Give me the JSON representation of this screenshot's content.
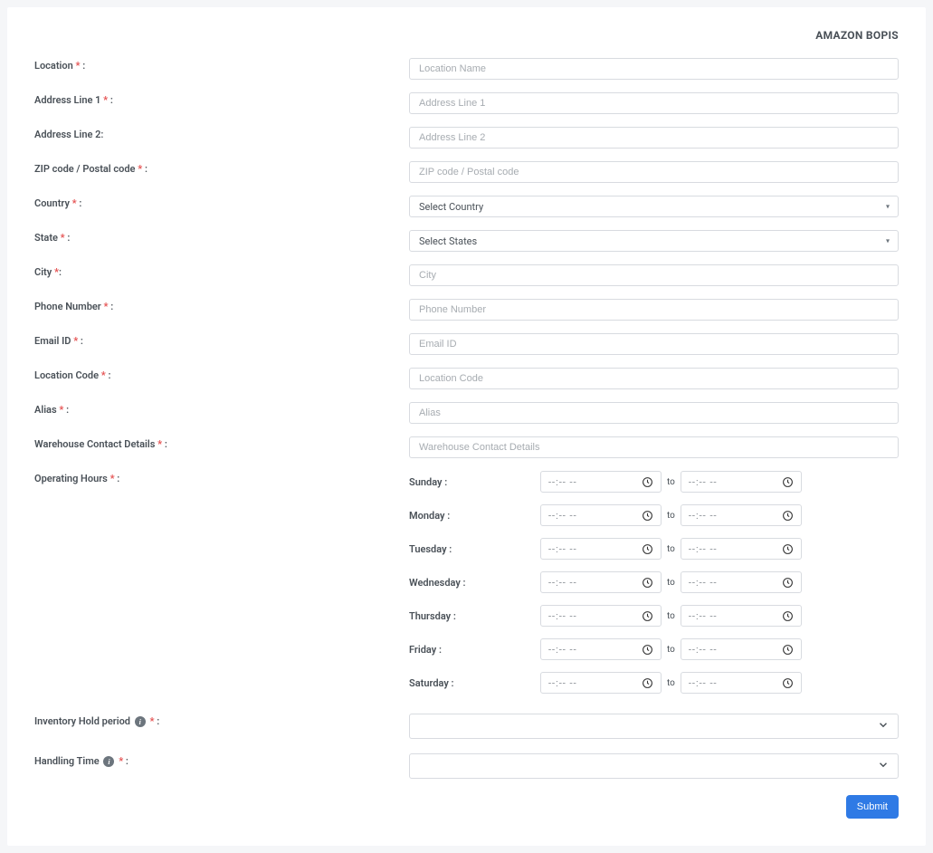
{
  "title": "AMAZON BOPIS",
  "labels": {
    "location": "Location",
    "address1": "Address Line 1",
    "address2": "Address Line 2:",
    "zip": "ZIP code / Postal code",
    "country": "Country",
    "state": "State",
    "city": "City",
    "phone": "Phone Number",
    "email": "Email ID",
    "locationCode": "Location Code",
    "alias": "Alias",
    "warehouseContact": "Warehouse Contact Details",
    "operatingHours": "Operating Hours",
    "inventoryHold": "Inventory Hold period",
    "handlingTime": "Handling Time"
  },
  "placeholders": {
    "location": "Location Name",
    "address1": "Address Line 1",
    "address2": "Address Line 2",
    "zip": "ZIP code / Postal code",
    "country": "Select Country",
    "state": "Select States",
    "city": "City",
    "phone": "Phone Number",
    "email": "Email ID",
    "locationCode": "Location Code",
    "alias": "Alias",
    "warehouseContact": "Warehouse Contact Details",
    "timeDash": "--:-- --"
  },
  "days": [
    "Sunday",
    "Monday",
    "Tuesday",
    "Wednesday",
    "Thursday",
    "Friday",
    "Saturday"
  ],
  "to": "to",
  "required": "*",
  "colon": " :",
  "submit": "Submit"
}
